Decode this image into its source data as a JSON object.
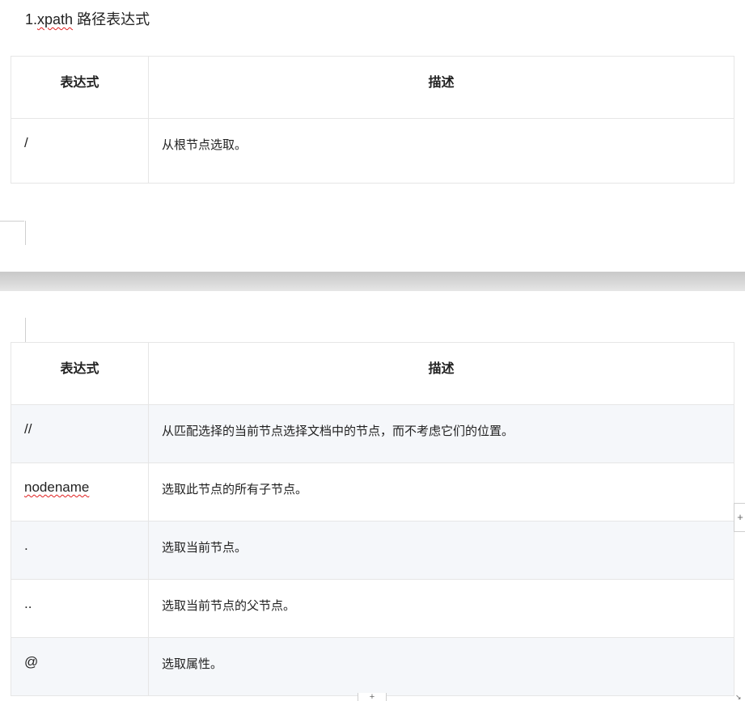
{
  "heading": {
    "prefix": "1.",
    "term": "xpath",
    "suffix": " 路径表达式"
  },
  "table1": {
    "headers": [
      "表达式",
      "描述"
    ],
    "rows": [
      {
        "expr": "/",
        "desc": "从根节点选取。"
      }
    ]
  },
  "table2": {
    "headers": [
      "表达式",
      "描述"
    ],
    "rows": [
      {
        "expr": "//",
        "desc": "从匹配选择的当前节点选择文档中的节点，而不考虑它们的位置。"
      },
      {
        "expr": "nodename",
        "desc": "选取此节点的所有子节点。"
      },
      {
        "expr": ".",
        "desc": "选取当前节点。"
      },
      {
        "expr": "..",
        "desc": "选取当前节点的父节点。"
      },
      {
        "expr": "@",
        "desc": "选取属性。"
      }
    ]
  },
  "controls": {
    "add_row_symbol": "+",
    "add_col_symbol": "+",
    "resize_symbol": "↘"
  }
}
